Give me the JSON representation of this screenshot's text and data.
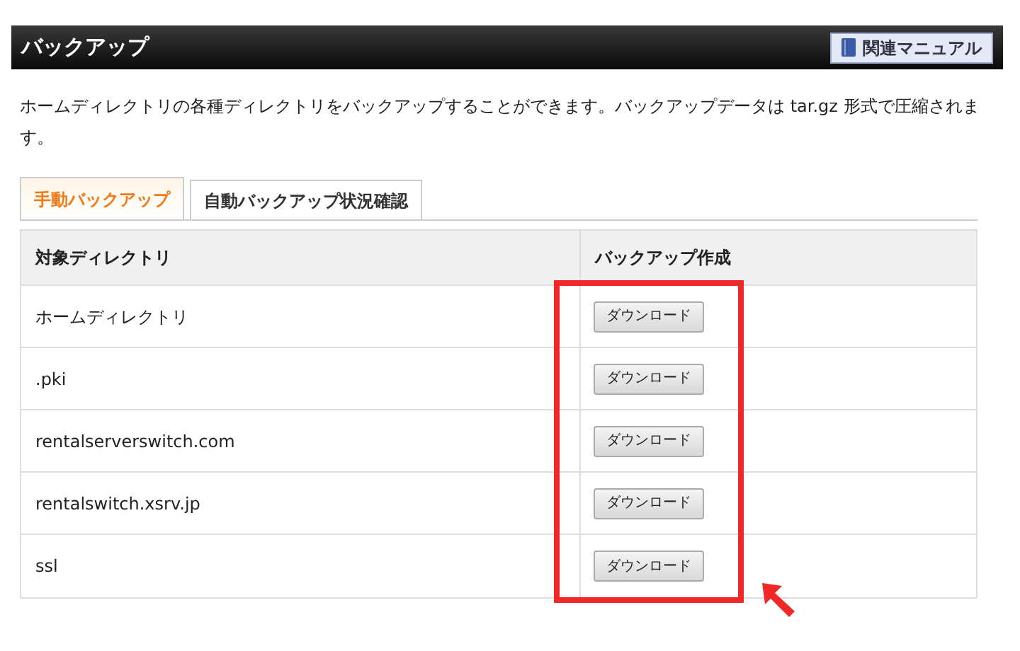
{
  "header": {
    "title": "バックアップ",
    "manual_button": "関連マニュアル"
  },
  "description": "ホームディレクトリの各種ディレクトリをバックアップすることができます。バックアップデータは tar.gz 形式で圧縮されます。",
  "tabs": [
    {
      "label": "手動バックアップ",
      "selected": true
    },
    {
      "label": "自動バックアップ状況確認",
      "selected": false
    }
  ],
  "table": {
    "columns": [
      "対象ディレクトリ",
      "バックアップ作成"
    ],
    "rows": [
      {
        "directory": "ホームディレクトリ",
        "button": "ダウンロード"
      },
      {
        "directory": ".pki",
        "button": "ダウンロード"
      },
      {
        "directory": "rentalserverswitch.com",
        "button": "ダウンロード"
      },
      {
        "directory": "rentalswitch.xsrv.jp",
        "button": "ダウンロード"
      },
      {
        "directory": "ssl",
        "button": "ダウンロード"
      }
    ]
  }
}
